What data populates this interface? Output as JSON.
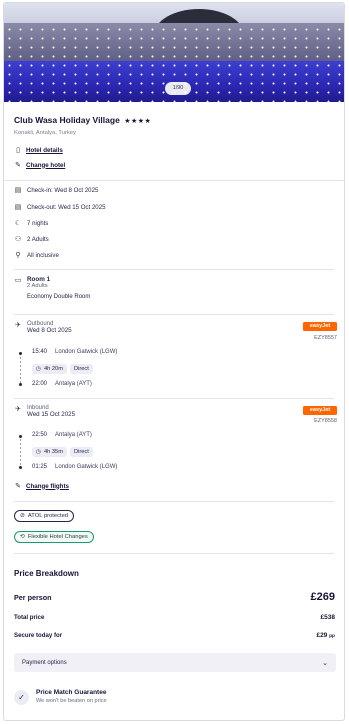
{
  "gallery": {
    "counter": "1/90"
  },
  "hotel": {
    "name": "Club Wasa Holiday Village",
    "stars": "★★★★",
    "location": "Konakli, Antalya, Turkey",
    "details_link": "Hotel details",
    "change_link": "Change hotel"
  },
  "stay": {
    "checkin": "Check-in: Wed 8 Oct 2025",
    "checkout": "Check-out: Wed 15 Oct 2025",
    "nights": "7 nights",
    "guests": "2 Adults",
    "board": "All inclusive"
  },
  "room": {
    "title": "Room 1",
    "guests": "2 Adults",
    "type": "Economy Double Room"
  },
  "outbound": {
    "label": "Outbound",
    "date": "Wed 8 Oct 2025",
    "airline": "easyJet",
    "flight_no": "EZY8557",
    "dep_time": "15:40",
    "dep_airport": "London Gatwick (LGW)",
    "duration": "4h 20m",
    "stops": "Direct",
    "arr_time": "22:00",
    "arr_airport": "Antalya (AYT)"
  },
  "inbound": {
    "label": "Inbound",
    "date": "Wed 15 Oct 2025",
    "airline": "easyJet",
    "flight_no": "EZY8558",
    "dep_time": "22:50",
    "dep_airport": "Antalya (AYT)",
    "duration": "4h 35m",
    "stops": "Direct",
    "arr_time": "01:25",
    "arr_airport": "London Gatwick (LGW)"
  },
  "change_flights": "Change flights",
  "badges": {
    "atol": "ATOL protected",
    "flex": "Flexible Hotel Changes"
  },
  "price": {
    "title": "Price Breakdown",
    "per_person_label": "Per person",
    "per_person": "£269",
    "total_label": "Total price",
    "total": "£538",
    "secure_label": "Secure today for",
    "secure": "£29",
    "secure_suffix": "pp"
  },
  "payment_options": "Payment options",
  "guarantee": {
    "title": "Price Match Guarantee",
    "subtitle": "We won't be beaten on price"
  },
  "colors": {
    "brand_orange": "#ff6600",
    "flex_green": "#1c9a6a",
    "text_dark": "#15153a"
  }
}
